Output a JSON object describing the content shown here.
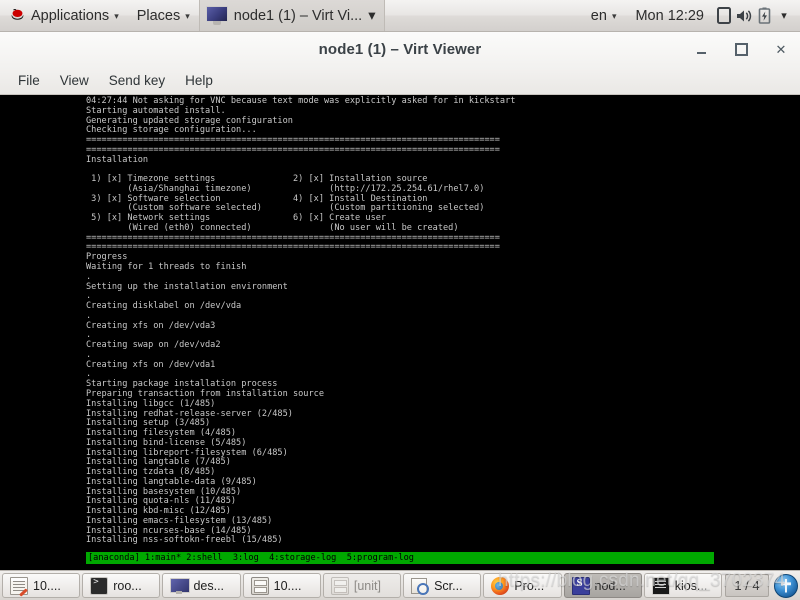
{
  "desktop_panel": {
    "logo_icon": "redhat-logo-icon",
    "applications_label": "Applications",
    "places_label": "Places",
    "window_title": "node1 (1) – Virt Vi...",
    "window_icon": "monitor-icon",
    "caret": "▾",
    "keyboard_layout": "en",
    "clock": "Mon 12:29",
    "tray": [
      {
        "name": "removable-media-icon",
        "glyph": "⎕"
      },
      {
        "name": "volume-icon",
        "glyph": "🔊"
      },
      {
        "name": "battery-icon",
        "glyph": "⚡"
      },
      {
        "name": "system-menu-caret-icon",
        "glyph": "▾"
      }
    ]
  },
  "window": {
    "title": "node1 (1) – Virt Viewer",
    "controls": {
      "minimize": "minimize-button",
      "maximize": "maximize-button",
      "close_glyph": "✕"
    },
    "menus": [
      {
        "label": "File"
      },
      {
        "label": "View"
      },
      {
        "label": "Send key"
      },
      {
        "label": "Help"
      }
    ]
  },
  "console": {
    "text": "04:27:44 Not asking for VNC because text mode was explicitly asked for in kickstart\nStarting automated install.\nGenerating updated storage configuration\nChecking storage configuration...\n================================================================================\n================================================================================\nInstallation\n\n 1) [x] Timezone settings               2) [x] Installation source\n        (Asia/Shanghai timezone)               (http://172.25.254.61/rhel7.0)\n 3) [x] Software selection              4) [x] Install Destination\n        (Custom software selected)             (Custom partitioning selected)\n 5) [x] Network settings                6) [x] Create user\n        (Wired (eth0) connected)               (No user will be created)\n================================================================================\n================================================================================\nProgress\nWaiting for 1 threads to finish\n.\nSetting up the installation environment\n.\nCreating disklabel on /dev/vda\n.\nCreating xfs on /dev/vda3\n.\nCreating swap on /dev/vda2\n.\nCreating xfs on /dev/vda1\n.\nStarting package installation process\nPreparing transaction from installation source\nInstalling libgcc (1/485)\nInstalling redhat-release-server (2/485)\nInstalling setup (3/485)\nInstalling filesystem (4/485)\nInstalling bind-license (5/485)\nInstalling libreport-filesystem (6/485)\nInstalling langtable (7/485)\nInstalling tzdata (8/485)\nInstalling langtable-data (9/485)\nInstalling basesystem (10/485)\nInstalling quota-nls (11/485)\nInstalling kbd-misc (12/485)\nInstalling emacs-filesystem (13/485)\nInstalling ncurses-base (14/485)\nInstalling nss-softokn-freebl (15/485)",
    "status_line": "[anaconda] 1:main* 2:shell  3:log  4:storage-log  5:program-log",
    "status_bg": "#00a800",
    "background": "#000000",
    "foreground": "#c8c8c8"
  },
  "taskbar": {
    "tasks": [
      {
        "label": "10....",
        "icon": "notepad-icon",
        "state": "normal"
      },
      {
        "label": "roo...",
        "icon": "terminal-icon",
        "state": "normal"
      },
      {
        "label": "des...",
        "icon": "monitor-icon",
        "state": "normal"
      },
      {
        "label": "10....",
        "icon": "file-drawer-icon",
        "state": "normal"
      },
      {
        "label": "[unit]",
        "icon": "file-drawer-icon",
        "state": "dimmed"
      },
      {
        "label": "Scr...",
        "icon": "screenshot-icon",
        "state": "normal"
      },
      {
        "label": "Pro...",
        "icon": "firefox-icon",
        "state": "normal"
      },
      {
        "label": "nod...",
        "icon": "selection-icon",
        "state": "active"
      },
      {
        "label": "kios...",
        "icon": "black-terminal-icon",
        "state": "normal"
      }
    ],
    "workspace_indicator": "1 / 4",
    "tray_icon": "accessibility-icon"
  },
  "watermark": {
    "text": "https://blog.csdn.net/qq_3702374"
  }
}
